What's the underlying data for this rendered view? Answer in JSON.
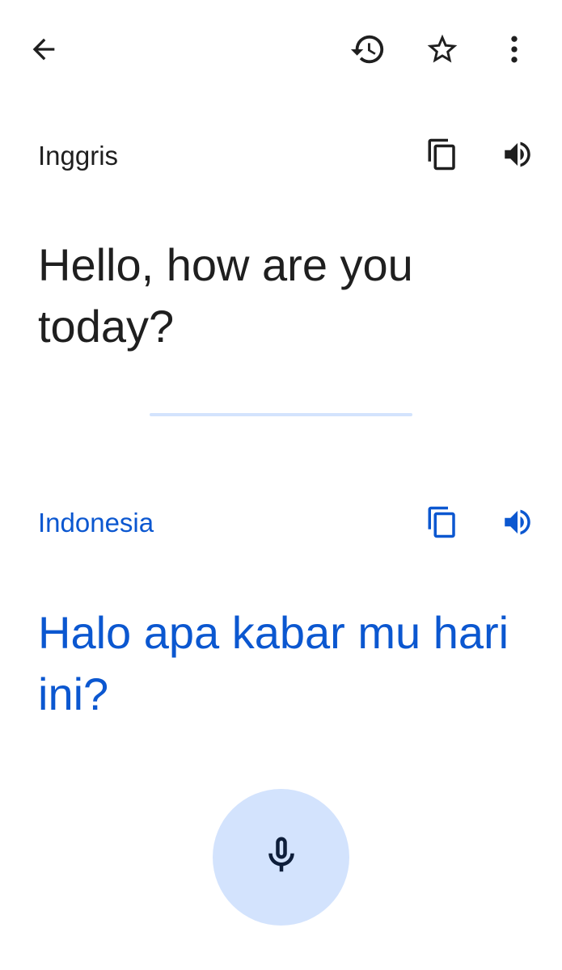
{
  "toolbar": {
    "back_icon": "arrow-back-icon",
    "history_icon": "history-icon",
    "favorite_icon": "star-outline-icon",
    "more_icon": "more-vert-icon"
  },
  "source": {
    "language": "Inggris",
    "text": "Hello, how are you today?",
    "copy_icon": "copy-icon",
    "speak_icon": "volume-icon"
  },
  "target": {
    "language": "Indonesia",
    "text": "Halo apa kabar mu hari ini?",
    "copy_icon": "copy-icon",
    "speak_icon": "volume-icon"
  },
  "mic": {
    "icon": "microphone-icon"
  },
  "colors": {
    "accent": "#0b57d0",
    "accent_light": "#d3e3fd",
    "text_primary": "#1f1f1f",
    "icon_dark": "#1f1f1f"
  }
}
